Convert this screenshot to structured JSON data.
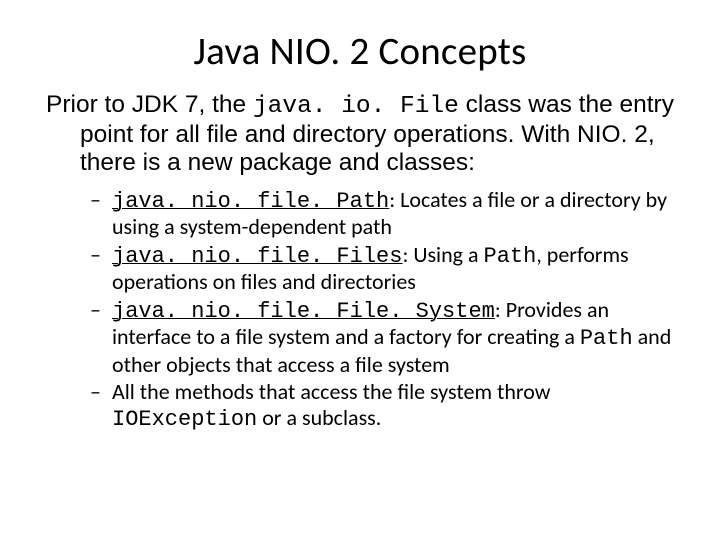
{
  "title": "Java NIO. 2 Concepts",
  "intro": {
    "lead": "Prior to JDK 7, the ",
    "code": "java. io. File",
    "tail": " class was the entry point for all file and directory operations. With NIO. 2, there is a new package and classes:"
  },
  "bullets": [
    {
      "code": "java. nio. file. Path",
      "sep": ": ",
      "text": "Locates a file or a directory by using a system-dependent path"
    },
    {
      "code": "java. nio. file. Files",
      "sep": ": ",
      "pre": "Using a ",
      "mid_code": "Path",
      "post": ", performs operations on files and directories"
    },
    {
      "code": "java. nio. file. File. System",
      "sep": ": ",
      "pre": "Provides an interface to a file system and a factory for creating a ",
      "mid_code": "Path",
      "post": " and other objects that access a file system"
    },
    {
      "pre": "All the methods that access the file system throw ",
      "mid_code": "IOException",
      "post": " or a subclass."
    }
  ]
}
